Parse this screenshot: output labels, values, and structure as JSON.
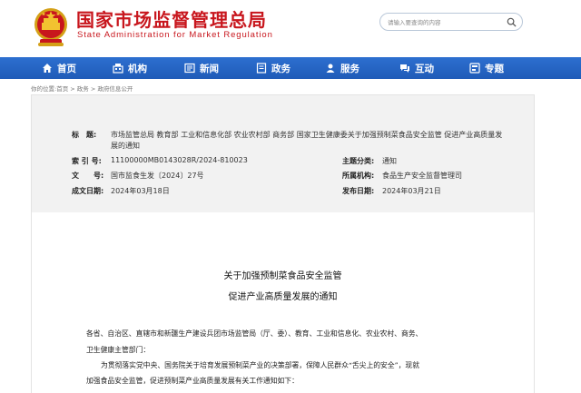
{
  "header": {
    "title": "国家市场监督管理总局",
    "subtitle": "State Administration for Market Regulation",
    "search_placeholder": "请输入要查询的内容"
  },
  "nav": {
    "items": [
      {
        "label": "首页",
        "icon": "home-icon"
      },
      {
        "label": "机构",
        "icon": "org-icon"
      },
      {
        "label": "新闻",
        "icon": "news-icon"
      },
      {
        "label": "政务",
        "icon": "gov-icon"
      },
      {
        "label": "服务",
        "icon": "service-icon"
      },
      {
        "label": "互动",
        "icon": "interact-icon"
      },
      {
        "label": "专题",
        "icon": "topic-icon"
      }
    ]
  },
  "breadcrumb": {
    "prefix": "你的位置:",
    "items": [
      "首页",
      "政务",
      "政府信息公开"
    ]
  },
  "meta": {
    "title_label": "标　题:",
    "title_value": "市场监管总局 教育部 工业和信息化部 农业农村部 商务部 国家卫生健康委关于加强预制菜食品安全监管 促进产业高质量发展的通知",
    "index_label": "索 引 号:",
    "index_value": "11100000MB0143028R/2024-810023",
    "topic_label": "主题分类:",
    "topic_value": "通知",
    "docno_label": "文　　号:",
    "docno_value": "国市监食生发〔2024〕27号",
    "org_label": "所属机构:",
    "org_value": "食品生产安全监督管理司",
    "created_label": "成文日期:",
    "created_value": "2024年03月18日",
    "published_label": "发布日期:",
    "published_value": "2024年03月21日"
  },
  "document": {
    "title_line1": "关于加强预制菜食品安全监管",
    "title_line2": "促进产业高质量发展的通知",
    "addressee_line1": "各省、自治区、直辖市和新疆生产建设兵团市场监管局（厅、委）、教育、工业和信息化、农业农村、商务、",
    "addressee_line2": "卫生健康主管部门：",
    "para1_line1": "为贯彻落实党中央、国务院关于培育发展预制菜产业的决策部署，保障人民群众“舌尖上的安全”，现就",
    "para1_line2": "加强食品安全监管，促进预制菜产业高质量发展有关工作通知如下："
  },
  "colors": {
    "brand_red": "#c8161d",
    "nav_blue": "#1f5bb8",
    "meta_bg": "#f2f2f2"
  }
}
